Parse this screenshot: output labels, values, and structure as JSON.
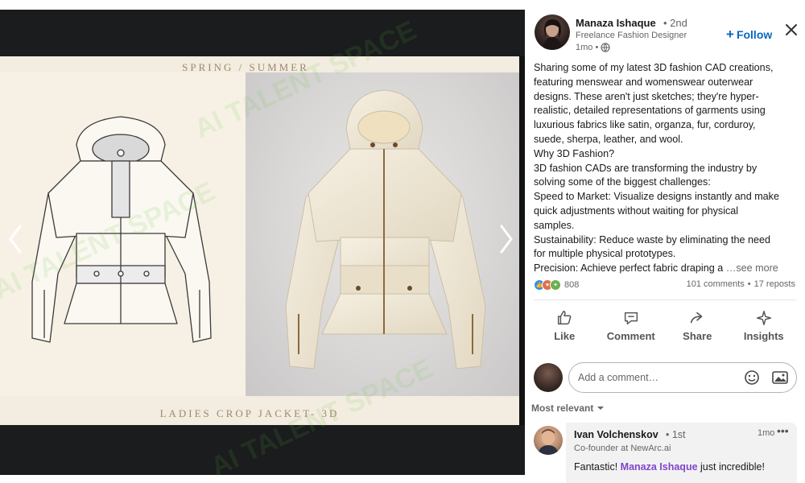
{
  "media": {
    "slide_top_label": "SPRING / SUMMER",
    "slide_bottom_label": "LADIES CROP JACKET- 3D",
    "watermark_text": "AI TALENT SPACE"
  },
  "author": {
    "name": "Manaza Ishaque",
    "degree": "• 2nd",
    "headline": "Freelance Fashion Designer",
    "time": "1mo •",
    "follow_label": "Follow"
  },
  "post": {
    "lines": [
      "Sharing some of my latest 3D fashion CAD creations,",
      "featuring menswear and womenswear outerwear",
      "designs. These aren't just sketches; they're hyper-",
      "realistic, detailed representations of garments using",
      "luxurious fabrics like satin, organza, fur, corduroy,",
      "suede, sherpa, leather, and wool.",
      "Why 3D Fashion?",
      "3D fashion CADs are transforming the industry by",
      "solving some of the biggest challenges:",
      "Speed to Market: Visualize designs instantly and make",
      "quick adjustments without waiting for physical",
      "samples.",
      "Sustainability: Reduce waste by eliminating the need",
      "for multiple physical prototypes."
    ],
    "last_line": "Precision: Achieve perfect fabric draping a",
    "see_more": "…see more"
  },
  "social": {
    "reaction_count": "808",
    "comments": "101 comments",
    "separator": "•",
    "reposts": "17 reposts"
  },
  "actions": {
    "like": "Like",
    "comment": "Comment",
    "share": "Share",
    "insights": "Insights"
  },
  "comment_box": {
    "placeholder": "Add a comment…"
  },
  "sort": {
    "label": "Most relevant"
  },
  "comment": {
    "name": "Ivan Volchenskov",
    "degree": "• 1st",
    "time": "1mo",
    "more": "•••",
    "headline": "Co-founder at NewArc.ai",
    "text_before": "Fantastic! ",
    "mention": "Manaza Ishaque",
    "text_after": " just incredible!"
  },
  "colors": {
    "accent": "#0a66c2",
    "mention": "#8344cc",
    "like_blue": "#378fe9",
    "love_red": "#df704d",
    "celebrate_green": "#6dae4f"
  },
  "icons": {
    "close": "close-icon",
    "globe": "globe-icon",
    "like": "thumbs-up-icon",
    "comment": "comment-bubble-icon",
    "share": "share-arrow-icon",
    "insights": "sparkle-icon",
    "emoji": "emoji-icon",
    "image": "image-icon",
    "sort": "chevron-down-icon",
    "prev": "chevron-left-icon",
    "next": "chevron-right-icon"
  }
}
